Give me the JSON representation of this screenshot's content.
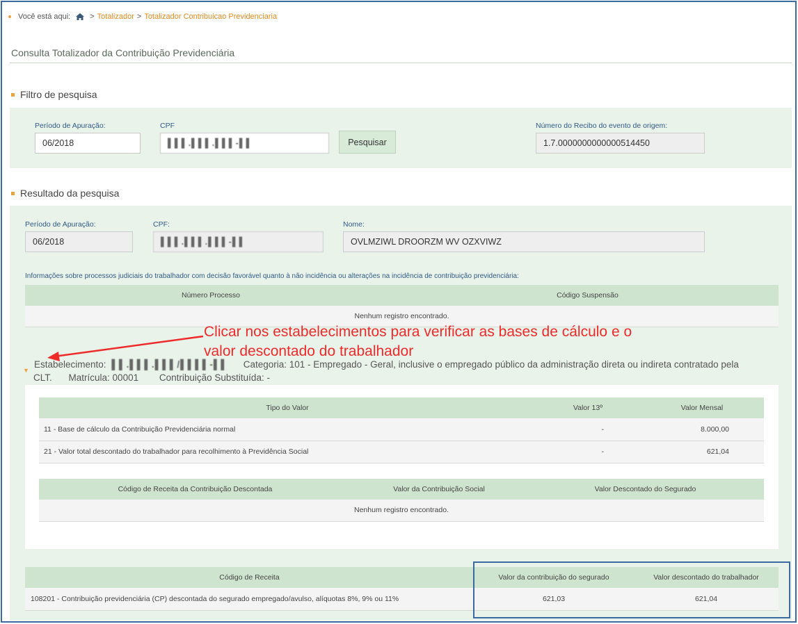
{
  "breadcrumb": {
    "prefix": "Você está aqui:",
    "home_icon": "home-icon",
    "sep": ">",
    "link1": "Totalizador",
    "link2": "Totalizador Contribuicao Previdenciaria"
  },
  "page_title": "Consulta Totalizador da Contribuição Previdenciária",
  "filtro": {
    "title": "Filtro de pesquisa",
    "periodo_label": "Período de Apuração:",
    "periodo_value": "06/2018",
    "cpf_label": "CPF",
    "cpf_value": "▌▌▌.▌▌▌.▌▌▌-▌▌",
    "pesquisar": "Pesquisar",
    "recibo_label": "Número do Recibo do evento de origem:",
    "recibo_value": "1.7.0000000000000514450"
  },
  "resultado": {
    "title": "Resultado da pesquisa",
    "periodo_label": "Período de Apuração:",
    "periodo_value": "06/2018",
    "cpf_label": "CPF:",
    "cpf_value": "▌▌▌.▌▌▌.▌▌▌-▌▌",
    "nome_label": "Nome:",
    "nome_value": "OVLMZIWL DROORZM WV OZXVIWZ",
    "info_text": "Informações sobre processos judiciais do trabalhador com decisão favorável quanto à não incidência ou alterações na incidência de contribuição previdenciária:",
    "processos": {
      "headers": [
        "Número Processo",
        "Código Suspensão"
      ],
      "empty": "Nenhum registro encontrado."
    }
  },
  "annotation": {
    "line1": "Clicar nos estabelecimentos para verificar as bases de cálculo e o",
    "line2": "valor descontado do trabalhador",
    "color": "#ee2a2a"
  },
  "estab": {
    "label": "Estabelecimento:",
    "value": "▌▌.▌▌▌.▌▌▌/▌▌▌▌-▌▌",
    "categoria": "Categoria: 101 - Empregado - Geral, inclusive o empregado público da administração direta ou indireta contratado pela",
    "clt": "CLT.",
    "matricula": "Matrícula: 00001",
    "contrib": "Contribuição Substituída: -"
  },
  "valores": {
    "headers": [
      "Tipo do Valor",
      "Valor 13º",
      "Valor Mensal"
    ],
    "rows": [
      {
        "tipo": "11 - Base de cálculo da Contribuição Previdenciária normal",
        "v13": "-",
        "mensal": "8.000,00"
      },
      {
        "tipo": "21 - Valor total descontado do trabalhador para recolhimento à Previdência Social",
        "v13": "-",
        "mensal": "621,04"
      }
    ]
  },
  "receita_desc": {
    "headers": [
      "Código de Receita da Contribuição Descontada",
      "Valor da Contribuição Social",
      "Valor Descontado do Segurado"
    ],
    "empty": "Nenhum registro encontrado."
  },
  "receita": {
    "headers": [
      "Código de Receita",
      "Valor da contribuição do segurado",
      "Valor descontado do trabalhador"
    ],
    "rows": [
      {
        "codigo": "108201 - Contribuição previdenciária (CP) descontada do segurado empregado/avulso, alíquotas 8%, 9% ou 11%",
        "contrib": "621,03",
        "desc": "621,04"
      }
    ]
  }
}
